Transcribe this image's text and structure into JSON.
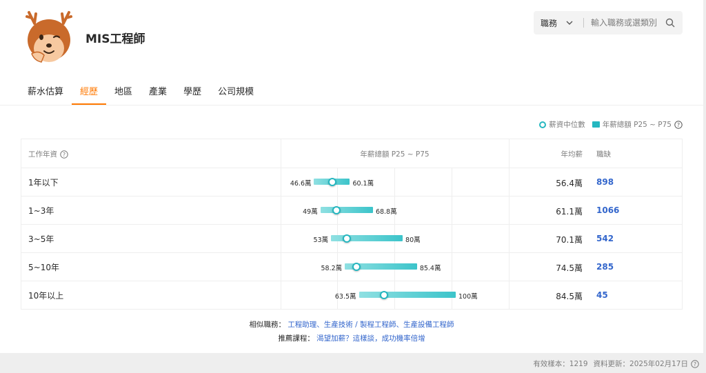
{
  "header": {
    "title": "MIS工程師"
  },
  "search": {
    "category": "職務",
    "placeholder": "輸入職務或選類別"
  },
  "tabs": [
    {
      "label": "薪水估算",
      "active": false
    },
    {
      "label": "經歷",
      "active": true
    },
    {
      "label": "地區",
      "active": false
    },
    {
      "label": "產業",
      "active": false
    },
    {
      "label": "學歷",
      "active": false
    },
    {
      "label": "公司規模",
      "active": false
    }
  ],
  "legend": {
    "median_label": "薪資中位數",
    "range_label": "年薪總額 P25 ~ P75"
  },
  "table": {
    "headers": {
      "years": "工作年資",
      "range": "年薪總額 P25 ~ P75",
      "avg": "年均薪",
      "jobs": "職缺"
    },
    "rows": [
      {
        "years": "1年以下",
        "p25": "46.6萬",
        "p75": "60.1萬",
        "avg": "56.4萬",
        "jobs": "898"
      },
      {
        "years": "1~3年",
        "p25": "49萬",
        "p75": "68.8萬",
        "avg": "61.1萬",
        "jobs": "1066"
      },
      {
        "years": "3~5年",
        "p25": "53萬",
        "p75": "80萬",
        "avg": "70.1萬",
        "jobs": "542"
      },
      {
        "years": "5~10年",
        "p25": "58.2萬",
        "p75": "85.4萬",
        "avg": "74.5萬",
        "jobs": "285"
      },
      {
        "years": "10年以上",
        "p25": "63.5萬",
        "p75": "100萬",
        "avg": "84.5萬",
        "jobs": "45"
      }
    ]
  },
  "chart_data": {
    "type": "bar",
    "title": "年薪總額 P25 ~ P75",
    "categories": [
      "1年以下",
      "1~3年",
      "3~5年",
      "5~10年",
      "10年以上"
    ],
    "series": [
      {
        "name": "P25",
        "values": [
          46.6,
          49,
          53,
          58.2,
          63.5
        ]
      },
      {
        "name": "P75",
        "values": [
          60.1,
          68.8,
          80,
          85.4,
          100
        ]
      },
      {
        "name": "薪資中位數",
        "values": [
          53.5,
          55,
          59,
          62.5,
          73
        ]
      }
    ],
    "xlim": [
      34,
      120
    ],
    "grid": true
  },
  "footer": {
    "similar_label": "相似職務：",
    "similar_jobs": "工程助理、生產技術 / 製程工程師、生產設備工程師",
    "courses_label": "推薦課程：",
    "course": "渴望加薪？這樣談，成功機率倍增",
    "samples": "有效樣本：1219",
    "updated": "資料更新：2025年02月17日"
  }
}
